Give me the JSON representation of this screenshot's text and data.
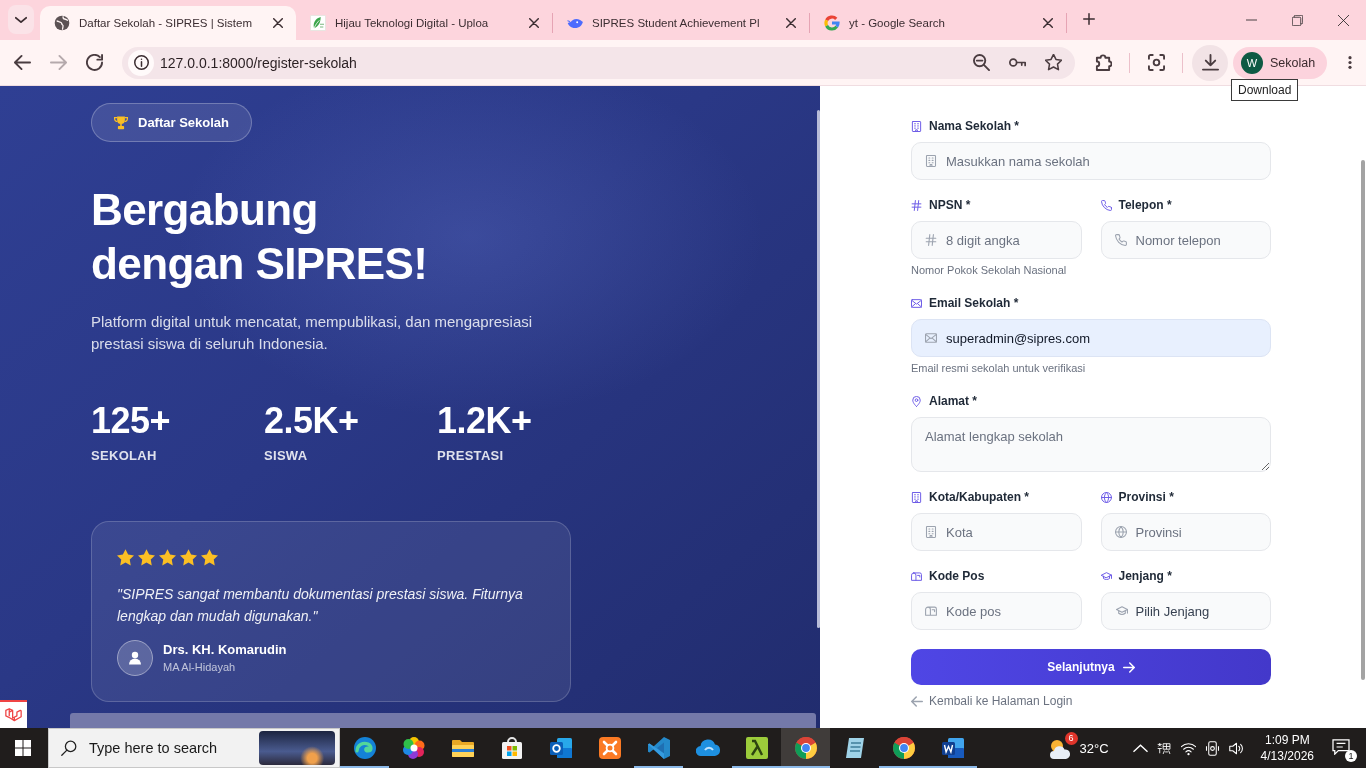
{
  "browser": {
    "tabs": [
      {
        "title": "Daftar Sekolah - SIPRES | Sistem",
        "selected": true
      },
      {
        "title": "Hijau Teknologi Digital - Uploa",
        "selected": false
      },
      {
        "title": "SIPRES Student Achievement Pl",
        "selected": false
      },
      {
        "title": "yt - Google Search",
        "selected": false
      }
    ],
    "forward_disabled": true,
    "address": "127.0.0.1:8000/register-sekolah",
    "profile": {
      "initial": "W",
      "name": "Sekolah"
    },
    "tooltip": "Download"
  },
  "hero": {
    "badge": "Daftar Sekolah",
    "heading": [
      "Bergabung",
      "dengan SIPRES!"
    ],
    "description": "Platform digital untuk mencatat, mempublikasi, dan mengapresiasi prestasi siswa di seluruh Indonesia.",
    "stats": [
      {
        "value": "125+",
        "label": "SEKOLAH"
      },
      {
        "value": "2.5K+",
        "label": "SISWA"
      },
      {
        "value": "1.2K+",
        "label": "PRESTASI"
      }
    ],
    "testimonial": {
      "stars": 5,
      "quote": "\"SIPRES sangat membantu dokumentasi prestasi siswa. Fiturnya lengkap dan mudah digunakan.\"",
      "name": "Drs. KH. Komarudin",
      "school": "MA Al-Hidayah"
    }
  },
  "form": {
    "rows": [
      [
        {
          "kind": "text",
          "label": "Nama Sekolah *",
          "placeholder": "Masukkan nama sekolah",
          "autofilled": false
        }
      ],
      [
        {
          "kind": "text",
          "label": "NPSN *",
          "placeholder": "8 digit angka",
          "hint": "Nomor Pokok Sekolah Nasional",
          "autofilled": false
        },
        {
          "kind": "text",
          "label": "Telepon *",
          "placeholder": "Nomor telepon",
          "autofilled": false
        }
      ],
      [
        {
          "kind": "text",
          "label": "Email Sekolah *",
          "value": "superadmin@sipres.com",
          "hint": "Email resmi sekolah untuk verifikasi",
          "autofilled": true
        }
      ],
      [
        {
          "kind": "textarea",
          "label": "Alamat *",
          "placeholder": "Alamat lengkap sekolah",
          "autofilled": false
        }
      ],
      [
        {
          "kind": "text",
          "label": "Kota/Kabupaten *",
          "placeholder": "Kota",
          "autofilled": false
        },
        {
          "kind": "text",
          "label": "Provinsi *",
          "placeholder": "Provinsi",
          "autofilled": false
        }
      ],
      [
        {
          "kind": "text",
          "label": "Kode Pos",
          "placeholder": "Kode pos",
          "autofilled": false
        },
        {
          "kind": "select",
          "label": "Jenjang *",
          "value": "Pilih Jenjang",
          "autofilled": false
        }
      ]
    ],
    "submit": "Selanjutnya",
    "back_link": "Kembali ke Halaman Login"
  },
  "taskbar": {
    "search": {
      "placeholder": "Type here to search"
    },
    "apps": [
      {
        "selected": false,
        "running": true
      },
      {
        "selected": false,
        "running": false
      },
      {
        "selected": false,
        "running": false
      },
      {
        "selected": false,
        "running": false
      },
      {
        "selected": false,
        "running": false
      },
      {
        "selected": false,
        "running": false
      },
      {
        "selected": false,
        "running": true
      },
      {
        "selected": false,
        "running": false
      },
      {
        "selected": false,
        "running": true
      },
      {
        "selected": true,
        "running": true
      },
      {
        "selected": false,
        "running": false
      },
      {
        "selected": false,
        "running": true
      },
      {
        "selected": false,
        "running": true
      }
    ],
    "tray": {
      "weather_badge": "6",
      "temperature": "32°C",
      "time": "1:09 PM",
      "date": "4/13/2026",
      "notifications": "1"
    }
  }
}
